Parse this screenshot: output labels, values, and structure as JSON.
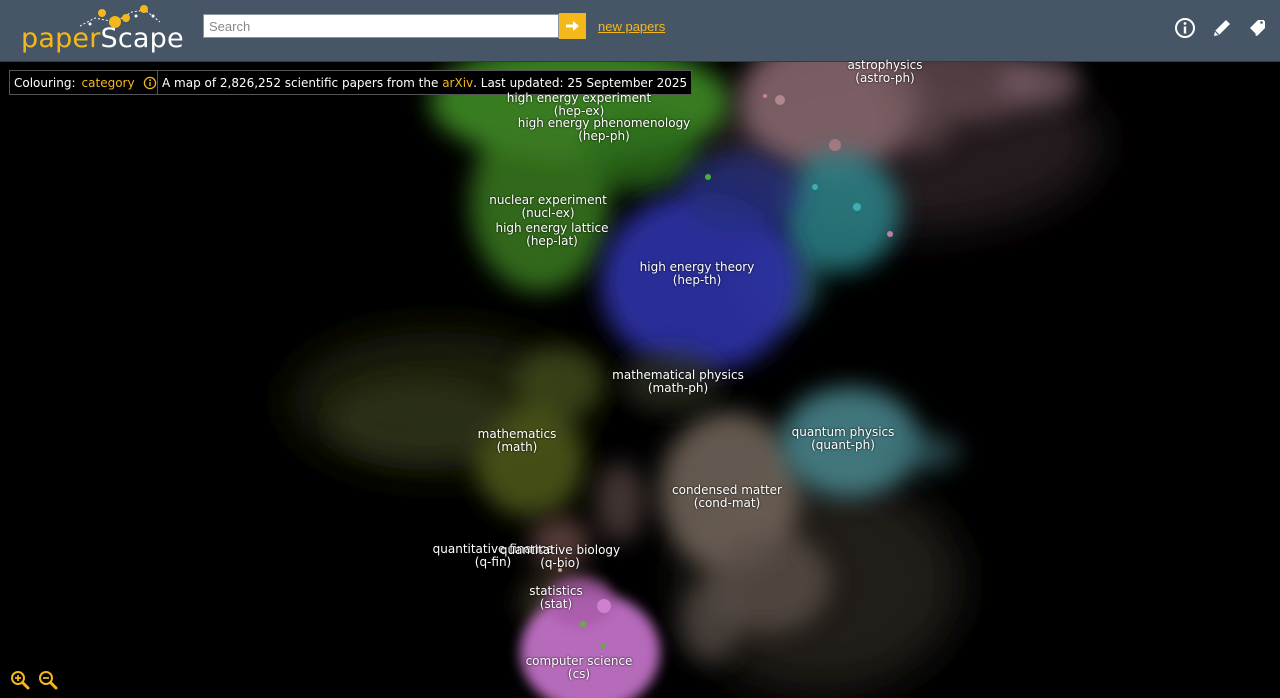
{
  "header": {
    "logo_part1": "paper",
    "logo_part2": "Scape",
    "search_placeholder": "Search",
    "search_button_icon": "arrow-right-icon",
    "new_papers_link": "new papers",
    "icons": [
      "info-icon",
      "pencil-icon",
      "tags-icon"
    ]
  },
  "colouring": {
    "label": "Colouring:",
    "value": "category",
    "icon": "info-icon"
  },
  "caption": {
    "text_before": "A map of 2,826,252 scientific papers from the",
    "link": "arXiv",
    "text_after": ". Last updated: 25 September 2025"
  },
  "map_labels": [
    {
      "name": "astrophysics",
      "code": "(astro-ph)"
    },
    {
      "name": "high energy experiment",
      "code": "(hep-ex)"
    },
    {
      "name": "high energy phenomenology",
      "code": "(hep-ph)"
    },
    {
      "name": "nuclear experiment",
      "code": "(nucl-ex)"
    },
    {
      "name": "high energy lattice",
      "code": "(hep-lat)"
    },
    {
      "name": "high energy theory",
      "code": "(hep-th)"
    },
    {
      "name": "mathematical physics",
      "code": "(math-ph)"
    },
    {
      "name": "quantum physics",
      "code": "(quant-ph)"
    },
    {
      "name": "mathematics",
      "code": "(math)"
    },
    {
      "name": "condensed matter",
      "code": "(cond-mat)"
    },
    {
      "name": "quantitative finance",
      "code": "(q-fin)"
    },
    {
      "name": "quantitative biology",
      "code": "(q-bio)"
    },
    {
      "name": "statistics",
      "code": "(stat)"
    },
    {
      "name": "computer science",
      "code": "(cs)"
    }
  ],
  "zoom": {
    "in_icon": "zoom-in-icon",
    "out_icon": "zoom-out-icon"
  },
  "colors": {
    "accent": "#f5b81b",
    "header_bg": "#465666",
    "hep": "#4a9a2a",
    "hep_th": "#2a2f9a",
    "astro": "#9a7a80",
    "quant": "#4aa7aa",
    "cond_mat": "#8a7a70",
    "math": "#4f5a1f",
    "cs": "#d07ad0"
  }
}
